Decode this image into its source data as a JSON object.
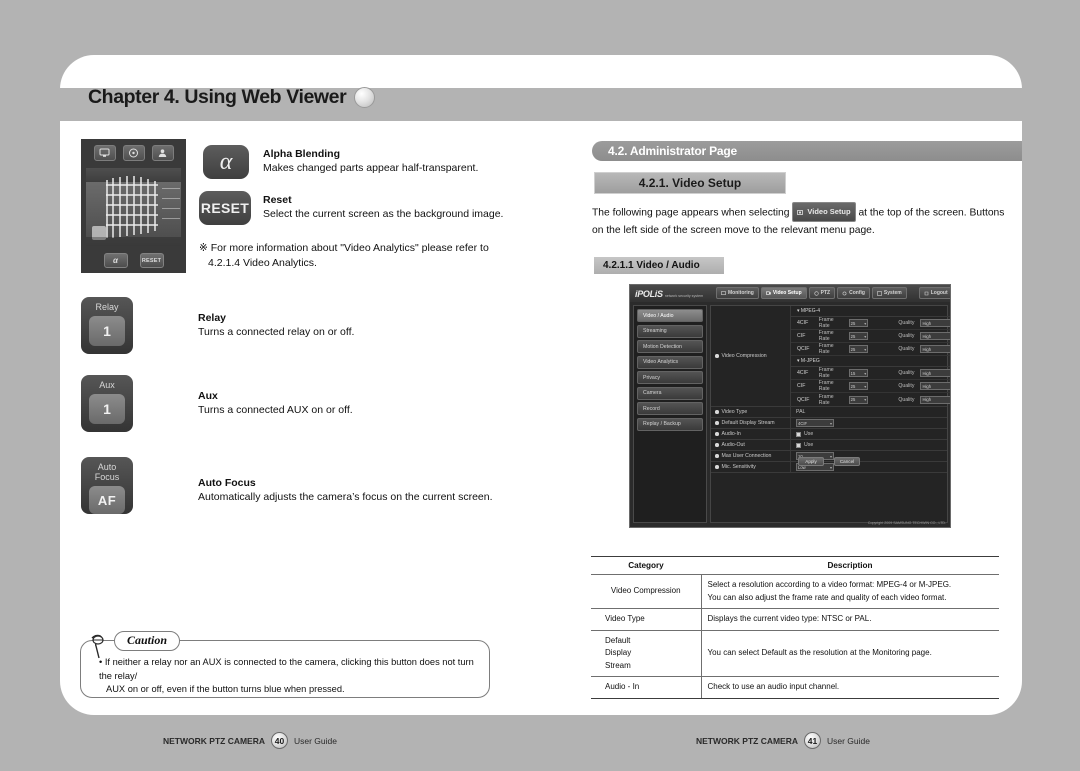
{
  "chapter": {
    "title": "Chapter 4. Using Web Viewer"
  },
  "left_page": {
    "thumbnail": {
      "top_buttons": [
        "monitor-icon",
        "dpad-icon",
        "person-icon"
      ],
      "bottom_buttons": [
        "α",
        "RESET"
      ]
    },
    "features": [
      {
        "icon_label": "α",
        "title": "Alpha Blending",
        "text": "Makes changed parts appear half-transparent."
      },
      {
        "icon_label": "RESET",
        "title": "Reset",
        "text": "Select the current screen as the background image."
      }
    ],
    "note": {
      "line1": "※ For more information about \"Video Analytics\" please refer to",
      "line2": "4.2.1.4 Video Analytics."
    },
    "controls": [
      {
        "cap": "Relay",
        "value": "1",
        "title": "Relay",
        "text": "Turns a connected relay on or off."
      },
      {
        "cap": "Aux",
        "value": "1",
        "title": "Aux",
        "text": "Turns a connected AUX on or off."
      },
      {
        "cap": "Auto\nFocus",
        "value": "AF",
        "title": "Auto Focus",
        "text": "Automatically adjusts the camera’s focus on the current screen."
      }
    ],
    "caution": {
      "label": "Caution",
      "line1": "• If neither a relay nor an AUX is connected to the camera, clicking this button does not turn the relay/",
      "line2": "AUX on or off, even if the button turns blue when pressed."
    },
    "footer": {
      "product": "NETWORK PTZ CAMERA",
      "page": "40",
      "guide": "User Guide"
    }
  },
  "right_page": {
    "h2": "4.2. Administrator Page",
    "h3": "4.2.1. Video Setup",
    "intro": {
      "before": "The following page appears when selecting",
      "chip": "Video Setup",
      "after": "at the top of the screen. Buttons on the left side of the screen move to the relevant menu page."
    },
    "h4": "4.2.1.1 Video / Audio",
    "screenshot": {
      "logo": "iPOLiS",
      "logo_tag": "network security system",
      "tabs": [
        {
          "label": "Monitoring",
          "active": false
        },
        {
          "label": "Video Setup",
          "active": true
        },
        {
          "label": "PTZ",
          "active": false
        },
        {
          "label": "Config",
          "active": false
        },
        {
          "label": "System",
          "active": false
        }
      ],
      "logout": "Logout",
      "sidebar": [
        {
          "label": "Video / Audio",
          "active": true
        },
        {
          "label": "Streaming",
          "active": false
        },
        {
          "label": "Motion Detection",
          "active": false
        },
        {
          "label": "Video Analytics",
          "active": false
        },
        {
          "label": "Privacy",
          "active": false
        },
        {
          "label": "Camera",
          "active": false
        },
        {
          "label": "Record",
          "active": false
        },
        {
          "label": "Replay / Backup",
          "active": false
        }
      ],
      "video_compression_label": "Video Compression",
      "groups": [
        {
          "name": "MPEG-4",
          "rows": [
            {
              "res": "4CIF",
              "fr_label": "Frame Rate",
              "fr_value": "25",
              "q_label": "Quality",
              "q_value": "High"
            },
            {
              "res": "CIF",
              "fr_label": "Frame Rate",
              "fr_value": "25",
              "q_label": "Quality",
              "q_value": "High"
            },
            {
              "res": "QCIF",
              "fr_label": "Frame Rate",
              "fr_value": "25",
              "q_label": "Quality",
              "q_value": "High"
            }
          ]
        },
        {
          "name": "M-JPEG",
          "rows": [
            {
              "res": "4CIF",
              "fr_label": "Frame Rate",
              "fr_value": "15",
              "q_label": "Quality",
              "q_value": "High"
            },
            {
              "res": "CIF",
              "fr_label": "Frame Rate",
              "fr_value": "25",
              "q_label": "Quality",
              "q_value": "High"
            },
            {
              "res": "QCIF",
              "fr_label": "Frame Rate",
              "fr_value": "25",
              "q_label": "Quality",
              "q_value": "High"
            }
          ]
        }
      ],
      "fields": [
        {
          "label": "Video Type",
          "value": "PAL",
          "kind": "text"
        },
        {
          "label": "Default Display Stream",
          "value": "4CIF",
          "kind": "select"
        },
        {
          "label": "Audio-In",
          "value": "Use",
          "kind": "check"
        },
        {
          "label": "Audio-Out",
          "value": "Use",
          "kind": "check"
        },
        {
          "label": "Max User Connection",
          "value": "10",
          "kind": "select"
        },
        {
          "label": "Mic. Sensitivity",
          "value": "Low",
          "kind": "select"
        }
      ],
      "buttons": {
        "apply": "Apply",
        "cancel": "Cancel"
      },
      "copyright": "Copyright 2009 SAMSUNG TECHWIN CO., LTD."
    },
    "table": {
      "headers": [
        "Category",
        "Description"
      ],
      "rows": [
        {
          "category": "Video Compression",
          "category_align": "center",
          "description": "Select a resolution according to a video format: MPEG-4 or M-JPEG.\nYou can also adjust the frame rate and quality of each video format."
        },
        {
          "category": "Video Type",
          "category_align": "left",
          "description": "Displays the current video type: NTSC or PAL."
        },
        {
          "category": "Default\nDisplay\nStream",
          "category_align": "left",
          "description": "You can select Default as the resolution at the Monitoring page."
        },
        {
          "category": "Audio - In",
          "category_align": "left",
          "description": "Check to use an audio input channel."
        }
      ]
    },
    "footer": {
      "product": "NETWORK PTZ CAMERA",
      "page": "41",
      "guide": "User Guide"
    }
  }
}
